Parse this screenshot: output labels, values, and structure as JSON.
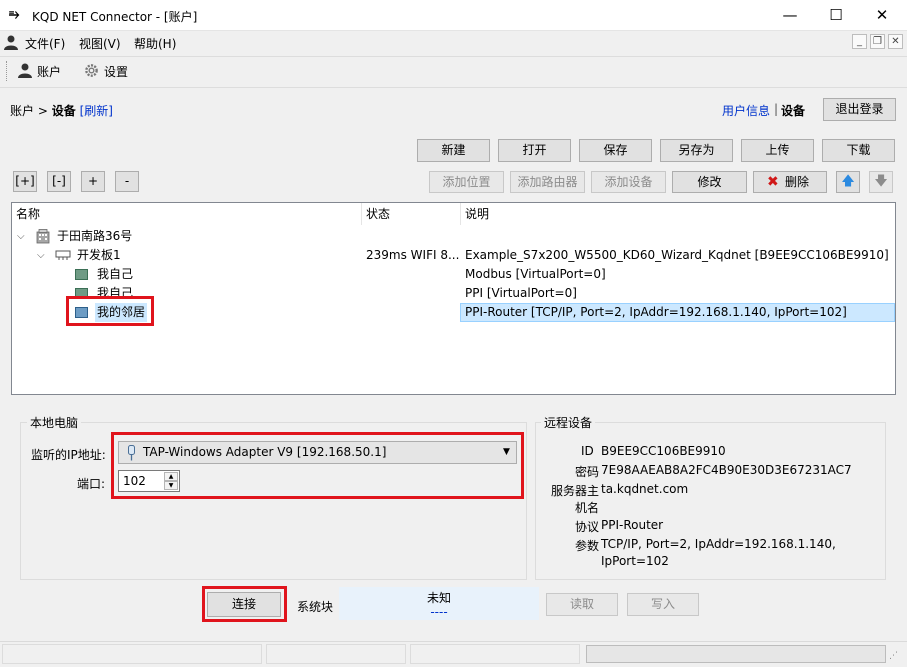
{
  "window": {
    "title": "KQD NET Connector - [账户]",
    "app_icon": "logo-icon",
    "min_glyph": "—",
    "max_glyph": "☐",
    "close_glyph": "✕"
  },
  "menu": {
    "items": [
      "文件(F)",
      "视图(V)",
      "帮助(H)"
    ],
    "mdi_min": "_",
    "mdi_restore": "❐",
    "mdi_close": "✕"
  },
  "toolbar": {
    "account_label": "账户",
    "settings_label": "设置"
  },
  "breadcrumb": {
    "root": "账户",
    "sep": ">",
    "current": "设备",
    "refresh": "[刷新]"
  },
  "topright": {
    "user_info": "用户信息",
    "sep": "|",
    "devices": "设备",
    "logout": "退出登录"
  },
  "actions_row1": [
    "新建",
    "打开",
    "保存",
    "另存为",
    "上传",
    "下载"
  ],
  "actions_row2": {
    "expand": "[+]",
    "collapse": "[-]",
    "plus": "+",
    "minus": "-",
    "add_location": "添加位置",
    "add_router": "添加路由器",
    "add_device": "添加设备",
    "modify": "修改",
    "delete": "删除",
    "up_glyph": "🡅",
    "down_glyph": "🡇"
  },
  "tree": {
    "columns": [
      "名称",
      "状态",
      "说明"
    ],
    "rows": [
      {
        "name": "于田南路36号",
        "status": "",
        "desc": ""
      },
      {
        "name": "开发板1",
        "status": "239ms WIFI 8...",
        "desc": "Example_S7x200_W5500_KD60_Wizard_Kqdnet [B9EE9CC106BE9910]"
      },
      {
        "name": "我自己",
        "status": "",
        "desc": "Modbus [VirtualPort=0]"
      },
      {
        "name": "我自己",
        "status": "",
        "desc": "PPI [VirtualPort=0]"
      },
      {
        "name": "我的邻居",
        "status": "",
        "desc": "PPI-Router [TCP/IP, Port=2, IpAddr=192.168.1.140, IpPort=102]"
      }
    ]
  },
  "local": {
    "title": "本地电脑",
    "ip_label": "监听的IP地址:",
    "ip_value": "TAP-Windows Adapter V9 [192.168.50.1]",
    "port_label": "端口:",
    "port_value": "102"
  },
  "remote": {
    "title": "远程设备",
    "id_label": "ID",
    "id_value": "B9EE9CC106BE9910",
    "pwd_label": "密码",
    "pwd_value": "7E98AAEAB8A2FC4B90E30D3E67231AC7",
    "server_label": "服务器主",
    "server_value": "ta.kqdnet.com",
    "host_label": "机名",
    "protocol_label": "协议",
    "protocol_value": "PPI-Router",
    "params_label": "参数",
    "params_value1": "TCP/IP, Port=2, IpAddr=192.168.1.140,",
    "params_value2": "IpPort=102"
  },
  "bottom": {
    "connect": "连接",
    "system_block": "系统块",
    "unknown": "未知",
    "dashes": "----",
    "read": "读取",
    "write": "写入"
  }
}
